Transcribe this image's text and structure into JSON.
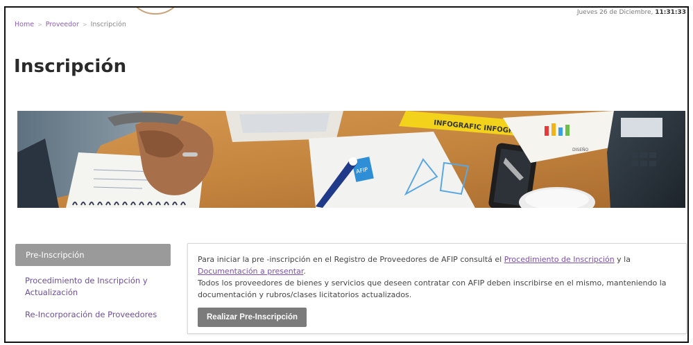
{
  "header": {
    "datetime_prefix": "Jueves 26 de Diciembre,",
    "datetime_time": "11:31:33"
  },
  "breadcrumb": {
    "items": [
      "Home",
      "Proveedor",
      "Inscripción"
    ],
    "separator": ">"
  },
  "page": {
    "title": "Inscripción"
  },
  "hero": {
    "description": "banner-photo-meeting",
    "sticker_text": "INFOGRAFIC INFOGRAPHIC",
    "card_text": "AFIP",
    "tag_text": "DISEÑO"
  },
  "sidebar": {
    "items": [
      {
        "label": "Pre-Inscripción",
        "active": true
      },
      {
        "label": "Procedimiento de Inscripción y Actualización",
        "active": false
      },
      {
        "label": "Re-Incorporación de Proveedores",
        "active": false
      }
    ]
  },
  "content": {
    "p1_start": "Para iniciar la pre -inscripción en el Registro de Proveedores de AFIP consultá el ",
    "link1": "Procedimiento de Inscripción",
    "p1_mid": " y la ",
    "link2": "Documentación a presentar",
    "p1_end": ".",
    "p2": "Todos los proveedores de bienes y servicios que deseen contratar con AFIP deben inscribirse en el mismo, manteniendo la documentación y rubros/clases licitatorios actualizados.",
    "button_label": "Realizar Pre-Inscripción"
  },
  "colors": {
    "link_purple": "#8b5fb0",
    "active_bg": "#9a9a9a",
    "button_bg": "#7b7b7b"
  }
}
